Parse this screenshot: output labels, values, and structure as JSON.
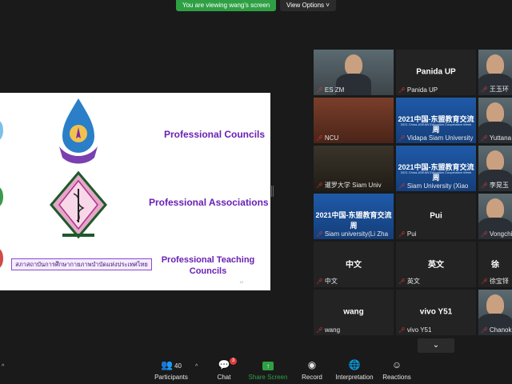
{
  "banner": {
    "text": "You are viewing wang's screen",
    "view_options": "View Options ˅"
  },
  "slide": {
    "titles": [
      "Professional Councils",
      "Professional Associations",
      "Professional Teaching Councils"
    ],
    "thai_text": "สภาสถาบันการศึกษากายภาพบำบัดแห่งประเทศไทย",
    "page_num": "10"
  },
  "tiles": [
    {
      "name": "ES ZM",
      "type": "video"
    },
    {
      "name": "Panida UP",
      "center": "Panida UP",
      "type": "name"
    },
    {
      "name": "王玉环",
      "type": "video"
    },
    {
      "name": "NCU",
      "type": "room"
    },
    {
      "name": "Vidapa Siam University",
      "type": "blue",
      "title": "2021中国-东盟教育交流周",
      "sub": "2021 China-ASEAN Education Cooperation Week"
    },
    {
      "name": "Yuttana M",
      "type": "video"
    },
    {
      "name": "暹罗大学 Siam Univ",
      "type": "dark"
    },
    {
      "name": "Siam University (Xiao",
      "type": "blue",
      "title": "2021中国-东盟教育交流周",
      "sub": "2021 China-ASEAN Education Cooperation Week"
    },
    {
      "name": "李晃玉",
      "type": "video"
    },
    {
      "name": "Siam university(Li Zha",
      "type": "blue",
      "title": "2021中国-东盟教育交流周",
      "sub": ""
    },
    {
      "name": "Pui",
      "center": "Pui",
      "type": "name"
    },
    {
      "name": "Vongchi",
      "type": "video"
    },
    {
      "name": "中文",
      "center": "中文",
      "type": "name"
    },
    {
      "name": "英文",
      "center": "英文",
      "type": "name"
    },
    {
      "name": "徐宝铎",
      "center": "徐",
      "type": "name"
    },
    {
      "name": "wang",
      "center": "wang",
      "type": "name"
    },
    {
      "name": "vivo Y51",
      "center": "vivo Y51",
      "type": "name"
    },
    {
      "name": "Chanok",
      "type": "video"
    }
  ],
  "toolbar": {
    "participants": {
      "label": "Participants",
      "count": "40"
    },
    "chat": {
      "label": "Chat",
      "badge": "3"
    },
    "share": {
      "label": "Share Screen"
    },
    "record": {
      "label": "Record"
    },
    "interpretation": {
      "label": "Interpretation"
    },
    "reactions": {
      "label": "Reactions"
    }
  },
  "icons": [
    "participants-icon",
    "chat-icon",
    "share-screen-icon",
    "record-icon",
    "interpretation-icon",
    "reactions-icon",
    "mic-muted-icon",
    "chevron-down-icon"
  ],
  "colors": {
    "accent": "#2ea043",
    "slide_text": "#6a1fb4",
    "muted": "#e03b3b"
  }
}
